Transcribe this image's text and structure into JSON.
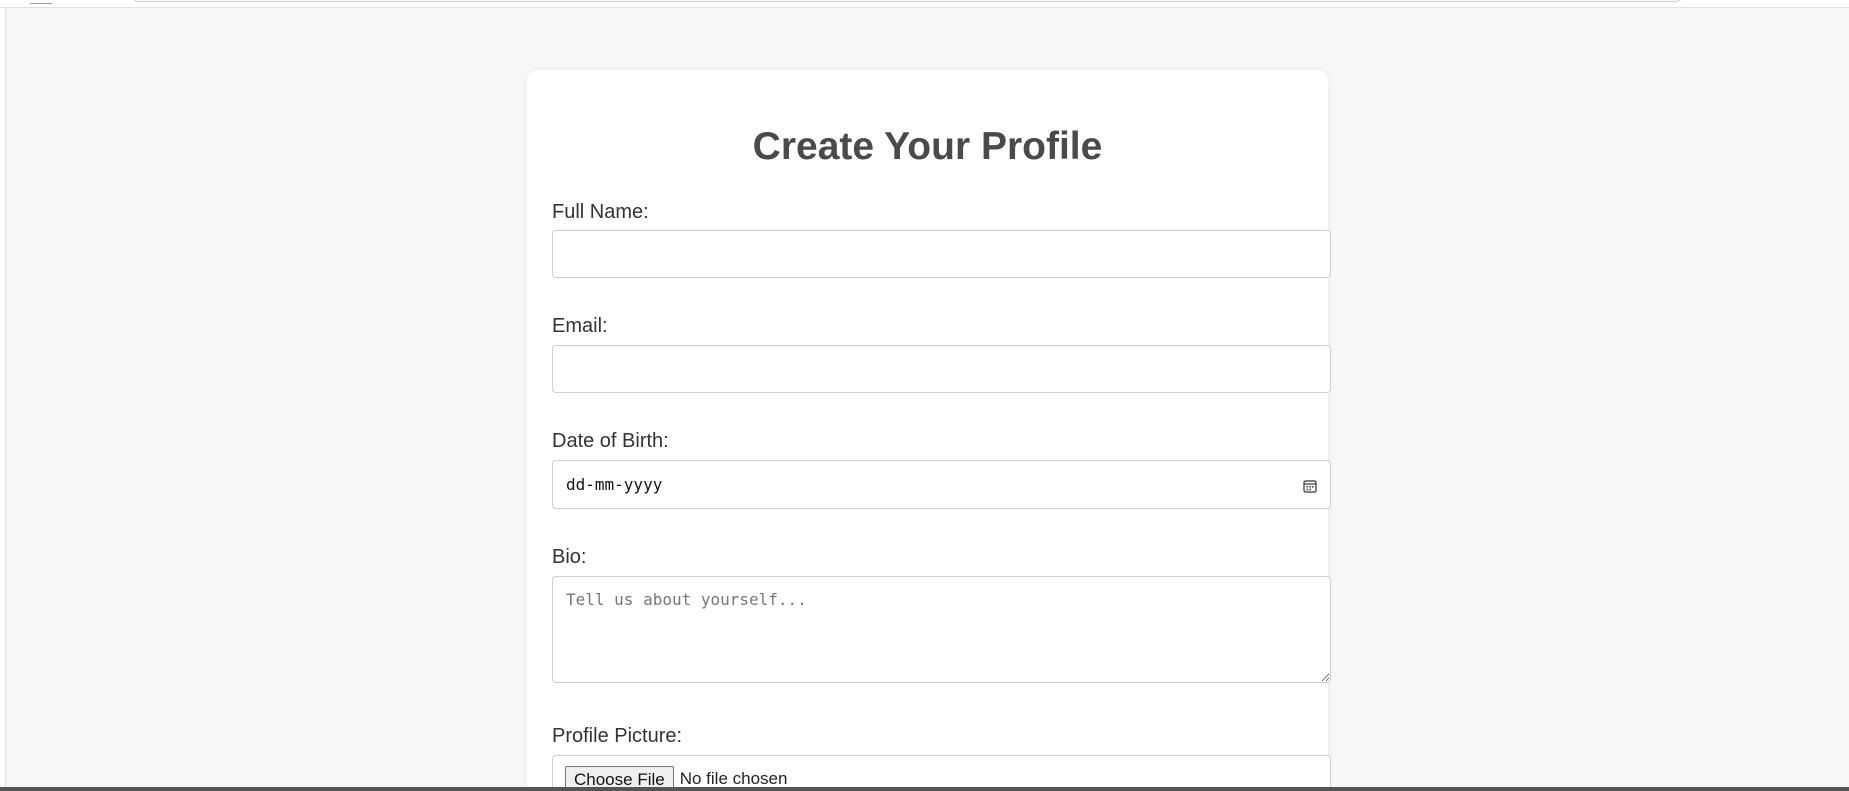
{
  "form": {
    "title": "Create Your Profile",
    "full_name": {
      "label": "Full Name:",
      "value": ""
    },
    "email": {
      "label": "Email:",
      "value": ""
    },
    "dob": {
      "label": "Date of Birth:",
      "value": "dd-mm-yyyy",
      "icon": "calendar-icon"
    },
    "bio": {
      "label": "Bio:",
      "placeholder": "Tell us about yourself..."
    },
    "picture": {
      "label": "Profile Picture:",
      "button": "Choose File",
      "status": "No file chosen"
    }
  },
  "colors": {
    "page_background": "#f7f7f7",
    "card_background": "#ffffff",
    "title_text": "#4a4a4a",
    "input_border": "#cfcfcf"
  }
}
